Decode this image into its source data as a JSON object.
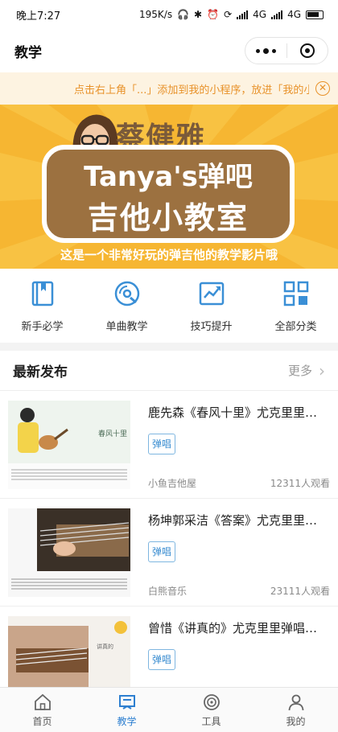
{
  "status_bar": {
    "time": "晚上7:27",
    "speed": "195K/s",
    "network1": "4G",
    "network2": "4G"
  },
  "nav": {
    "title": "教学"
  },
  "tip": {
    "text": "点击右上角「...」添加到我的小程序，放进「我的小程序」"
  },
  "banner": {
    "brand": "蔡健雅",
    "line1": "Tanya's弹吧",
    "line2": "吉他小教室",
    "tagline": "这是一个非常好玩的弹吉他的教学影片哦"
  },
  "categories": [
    {
      "label": "新手必学",
      "icon": "book-icon"
    },
    {
      "label": "单曲教学",
      "icon": "disc-icon"
    },
    {
      "label": "技巧提升",
      "icon": "trend-chart-icon"
    },
    {
      "label": "全部分类",
      "icon": "grid-icon"
    }
  ],
  "section": {
    "title": "最新发布",
    "more": "更多"
  },
  "videos": [
    {
      "title": "鹿先森《春风十里》尤克里里弹唱教学",
      "tag": "弹唱",
      "source": "小鱼吉他屋",
      "views": "12311人观看"
    },
    {
      "title": "杨坤郭采洁《答案》尤克里里弹唱教学",
      "tag": "弹唱",
      "source": "白熊音乐",
      "views": "23111人观看"
    },
    {
      "title": "曾惜《讲真的》尤克里里弹唱教学",
      "tag": "弹唱",
      "source": "",
      "views": ""
    }
  ],
  "tabs": [
    {
      "label": "首页",
      "icon": "home-icon",
      "active": false
    },
    {
      "label": "教学",
      "icon": "teach-icon",
      "active": true
    },
    {
      "label": "工具",
      "icon": "tool-icon",
      "active": false
    },
    {
      "label": "我的",
      "icon": "user-icon",
      "active": false
    }
  ],
  "colors": {
    "accent": "#2d7fd0",
    "banner": "#f6b632",
    "tip": "#e8922a"
  }
}
